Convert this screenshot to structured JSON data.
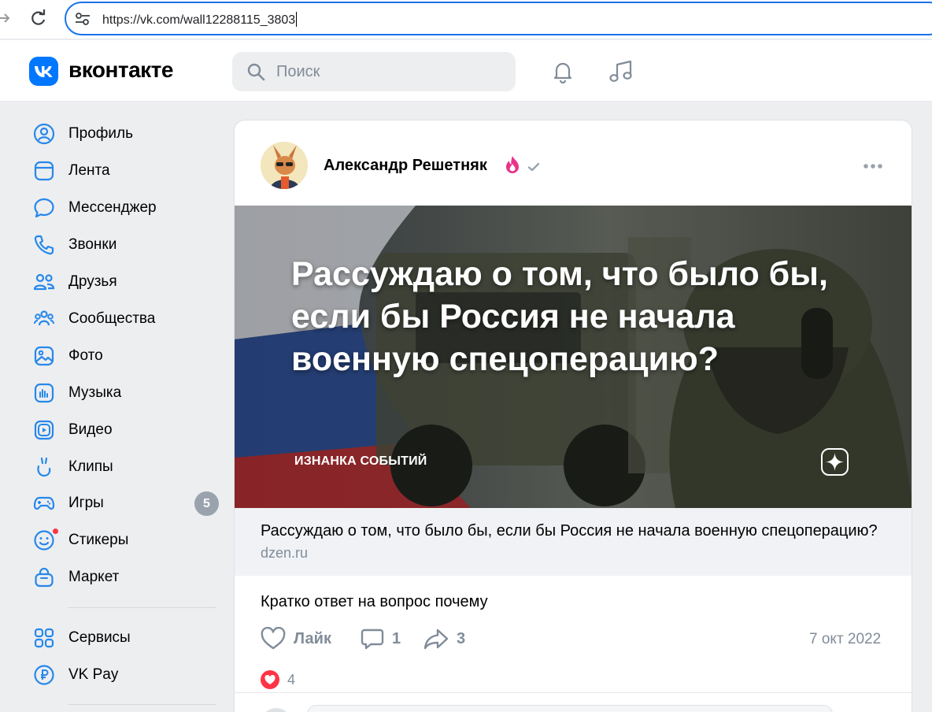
{
  "browser": {
    "url": "https://vk.com/wall12288115_3803"
  },
  "header": {
    "brand": "вконтакте",
    "search_placeholder": "Поиск"
  },
  "sidebar": {
    "items": [
      {
        "label": "Профиль",
        "icon": "profile-icon"
      },
      {
        "label": "Лента",
        "icon": "feed-icon"
      },
      {
        "label": "Мессенджер",
        "icon": "messenger-icon"
      },
      {
        "label": "Звонки",
        "icon": "phone-icon"
      },
      {
        "label": "Друзья",
        "icon": "friends-icon"
      },
      {
        "label": "Сообщества",
        "icon": "communities-icon"
      },
      {
        "label": "Фото",
        "icon": "photo-icon"
      },
      {
        "label": "Музыка",
        "icon": "music-icon"
      },
      {
        "label": "Видео",
        "icon": "video-icon"
      },
      {
        "label": "Клипы",
        "icon": "clips-icon"
      },
      {
        "label": "Игры",
        "icon": "games-icon",
        "badge": "5"
      },
      {
        "label": "Стикеры",
        "icon": "stickers-icon"
      },
      {
        "label": "Маркет",
        "icon": "market-icon"
      }
    ],
    "extra": [
      {
        "label": "Сервисы",
        "icon": "services-icon"
      },
      {
        "label": "VK Pay",
        "icon": "vkpay-icon"
      }
    ]
  },
  "post": {
    "author": "Александр Решетняк",
    "banner": {
      "title": "Рассуждаю о том, что было бы, если бы Россия не начала военную спецоперацию?",
      "tag": "ИЗНАНКА СОБЫТИЙ"
    },
    "link": {
      "title": "Рассуждаю о том, что было бы, если бы Россия не начала военную спецоперацию?",
      "domain": "dzen.ru"
    },
    "text": "Кратко ответ на вопрос почему",
    "like_label": "Лайк",
    "comments_count": "1",
    "shares_count": "3",
    "date": "7 окт 2022",
    "reactions_count": "4"
  },
  "colors": {
    "accent": "#0077ff",
    "badge": "#99a2ad",
    "muted": "#818c99",
    "reaction": "#ff3347"
  }
}
